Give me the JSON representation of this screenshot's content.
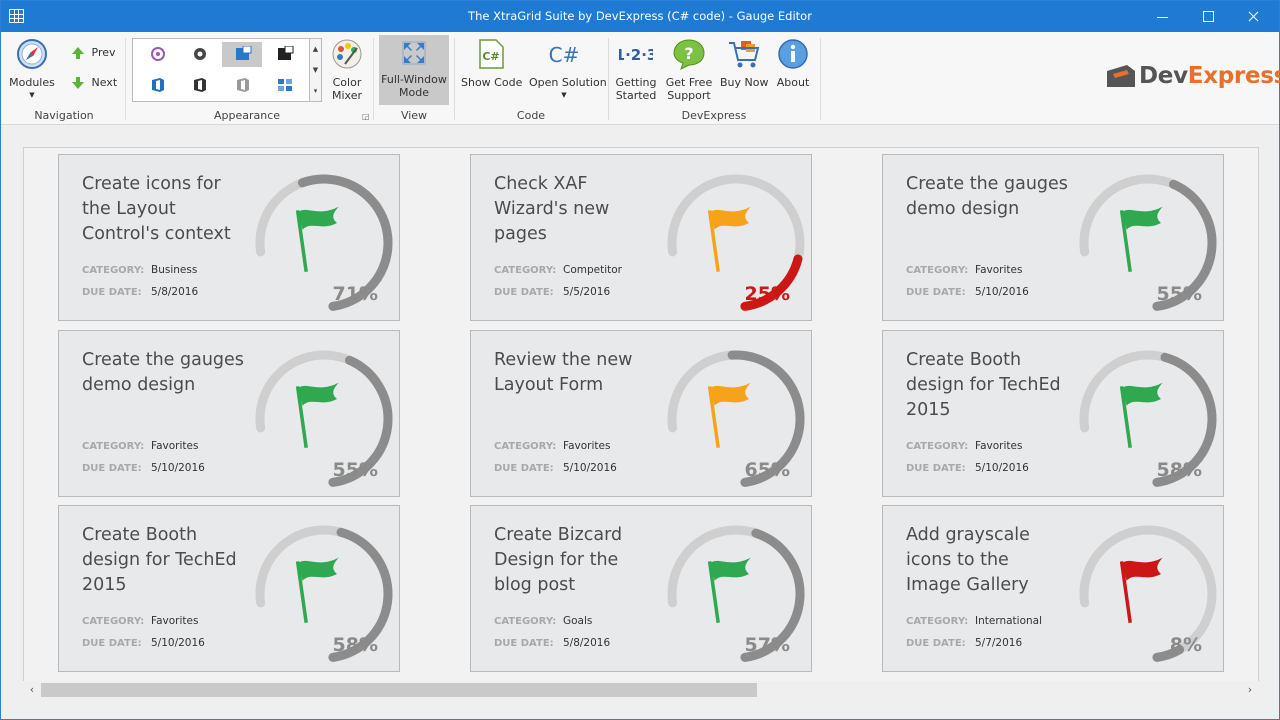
{
  "window": {
    "title": "The XtraGrid Suite by DevExpress (C# code) - Gauge Editor"
  },
  "ribbon": {
    "navigation": {
      "label": "Navigation",
      "modules": "Modules",
      "prev": "Prev",
      "next": "Next"
    },
    "appearance": {
      "label": "Appearance",
      "color_mixer": "Color\nMixer"
    },
    "view": {
      "label": "View",
      "full_window": "Full-Window\nMode"
    },
    "code": {
      "label": "Code",
      "show_code": "Show Code",
      "open_solution": "Open Solution"
    },
    "devexpress": {
      "label": "DevExpress",
      "getting_started": "Getting\nStarted",
      "get_support": "Get Free\nSupport",
      "buy_now": "Buy Now",
      "about": "About"
    },
    "logo_text": "DevExpress"
  },
  "labels": {
    "category": "CATEGORY:",
    "due_date": "DUE DATE:"
  },
  "cards": [
    {
      "title": "Create icons for\nthe Layout\nControl's context",
      "category": "Business",
      "due": "5/8/2016",
      "percent": 71,
      "percent_text": "71%",
      "flag_color": "#2fa84f",
      "arc_color": "#8c8c8c",
      "pct_color": "#8a8a8a"
    },
    {
      "title": "Check XAF\nWizard's new\npages",
      "category": "Competitor",
      "due": "5/5/2016",
      "percent": 25,
      "percent_text": "25%",
      "flag_color": "#f6a31b",
      "arc_color": "#cc1717",
      "pct_color": "#cc1717"
    },
    {
      "title": "Create the gauges\ndemo design",
      "category": "Favorites",
      "due": "5/10/2016",
      "percent": 55,
      "percent_text": "55%",
      "flag_color": "#2fa84f",
      "arc_color": "#8c8c8c",
      "pct_color": "#8a8a8a"
    },
    {
      "title": "Create the gauges\ndemo design",
      "category": "Favorites",
      "due": "5/10/2016",
      "percent": 55,
      "percent_text": "55%",
      "flag_color": "#2fa84f",
      "arc_color": "#8c8c8c",
      "pct_color": "#8a8a8a"
    },
    {
      "title": "Review the new\nLayout Form",
      "category": "Favorites",
      "due": "5/10/2016",
      "percent": 65,
      "percent_text": "65%",
      "flag_color": "#f6a31b",
      "arc_color": "#8c8c8c",
      "pct_color": "#8a8a8a"
    },
    {
      "title": "Create Booth\ndesign for TechEd\n2015",
      "category": "Favorites",
      "due": "5/10/2016",
      "percent": 58,
      "percent_text": "58%",
      "flag_color": "#2fa84f",
      "arc_color": "#8c8c8c",
      "pct_color": "#8a8a8a"
    },
    {
      "title": "Create Booth\ndesign for TechEd\n2015",
      "category": "Favorites",
      "due": "5/10/2016",
      "percent": 58,
      "percent_text": "58%",
      "flag_color": "#2fa84f",
      "arc_color": "#8c8c8c",
      "pct_color": "#8a8a8a"
    },
    {
      "title": "Create Bizcard\nDesign for the\nblog post",
      "category": "Goals",
      "due": "5/8/2016",
      "percent": 57,
      "percent_text": "57%",
      "flag_color": "#2fa84f",
      "arc_color": "#8c8c8c",
      "pct_color": "#8a8a8a"
    },
    {
      "title": "Add grayscale\nicons to the\nImage Gallery",
      "category": "International",
      "due": "5/7/2016",
      "percent": 8,
      "percent_text": "8%",
      "flag_color": "#cc1717",
      "arc_color": "#8c8c8c",
      "pct_color": "#8a8a8a"
    }
  ],
  "icons": {
    "app": "grid-icon",
    "modules": "compass-icon",
    "prev": "arrow-up-icon",
    "next": "arrow-down-icon",
    "color_mixer": "palette-icon",
    "full_window": "fullscreen-icon",
    "show_code": "csharp-file-icon",
    "open_solution": "csharp-icon",
    "getting_started": "123-icon",
    "support": "chat-question-icon",
    "buy": "cart-icon",
    "about": "info-icon",
    "flag": "flag-icon"
  }
}
